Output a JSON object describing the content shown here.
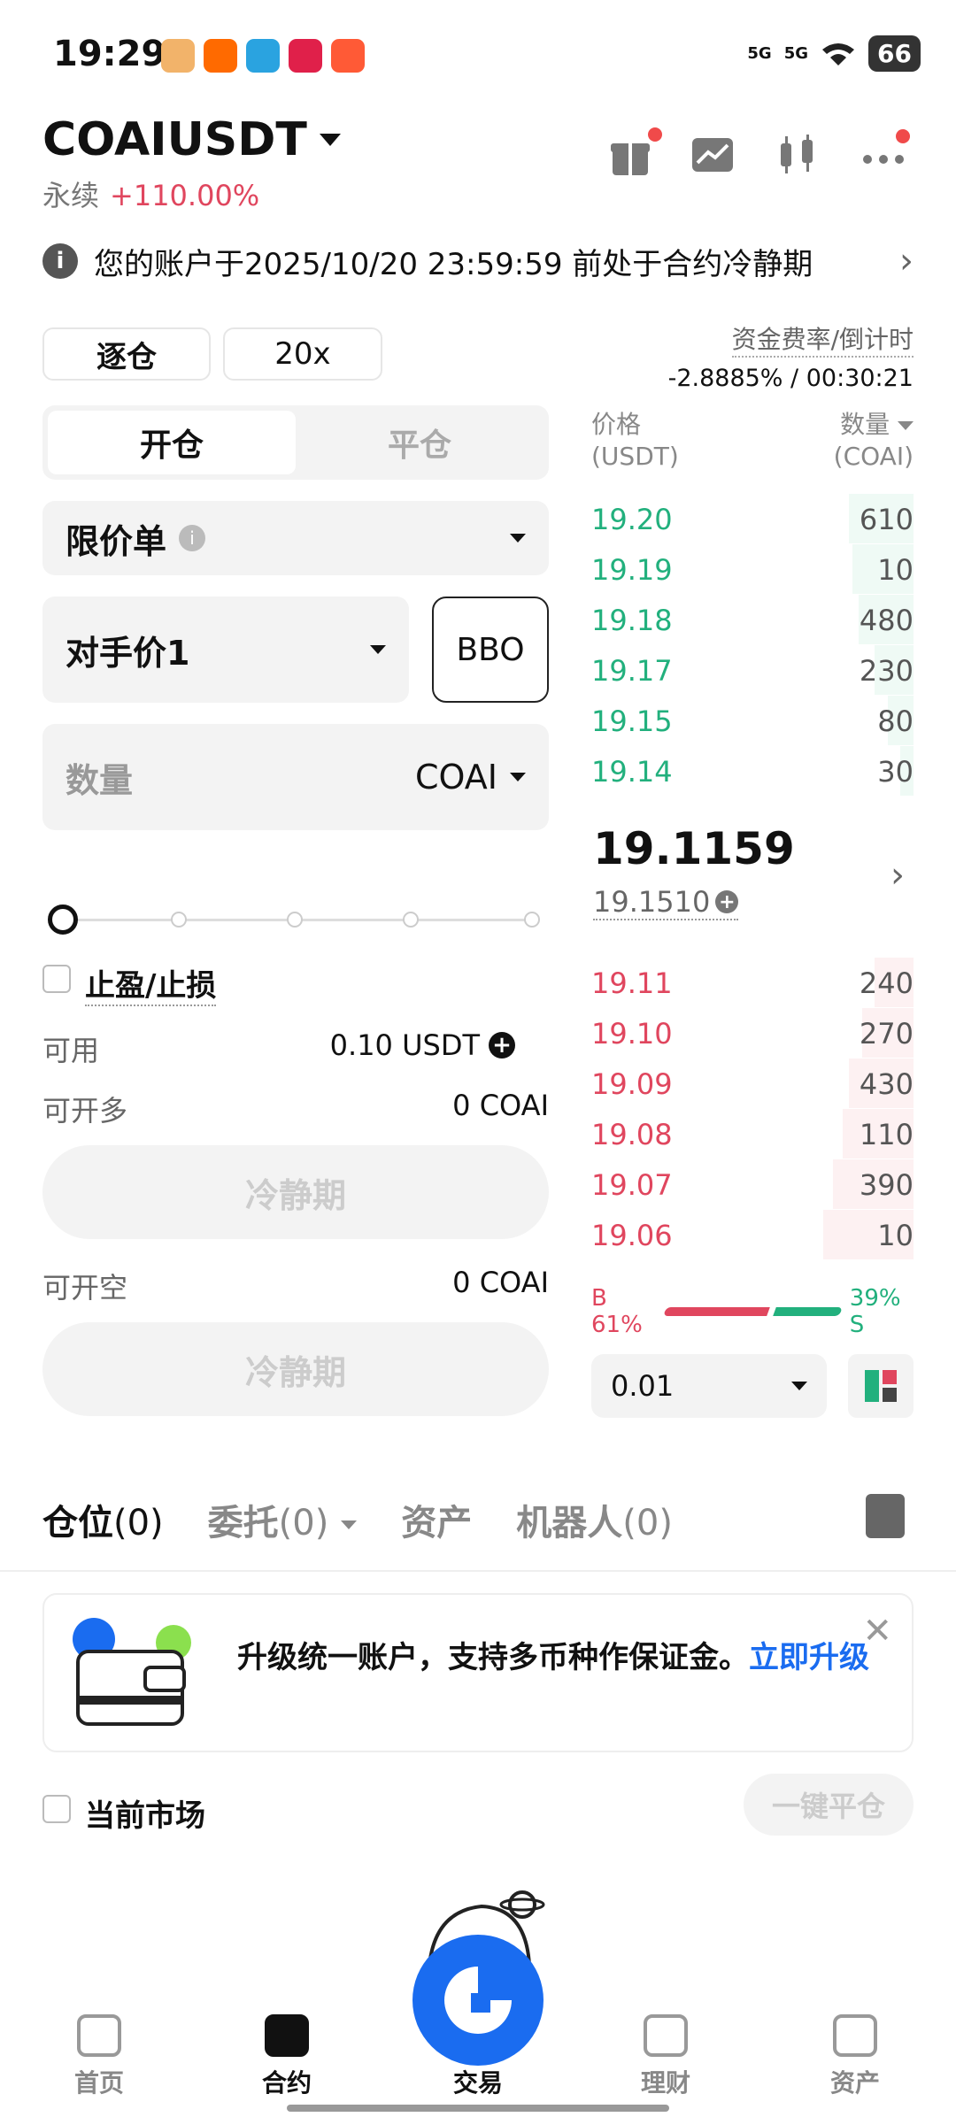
{
  "status_bar": {
    "time": "19:29",
    "signal1": "5G",
    "signal2": "5G",
    "battery": "66"
  },
  "header": {
    "pair": "COAIUSDT",
    "type": "永续",
    "change": "+110.00%"
  },
  "notice": {
    "text": "您的账户于2025/10/20 23:59:59 前处于合约冷静期"
  },
  "margin_mode": "逐仓",
  "leverage": "20x",
  "funding": {
    "label": "资金费率/倒计时",
    "value": "-2.8885% / 00:30:21"
  },
  "tabs_open_close": {
    "open": "开仓",
    "close": "平仓"
  },
  "order_type": "限价单",
  "price_mode": "对手价1",
  "bbo": "BBO",
  "quantity": {
    "label": "数量",
    "unit": "COAI"
  },
  "slider_percent": 0,
  "tp_sl": "止盈/止损",
  "available": {
    "label": "可用",
    "value": "0.10 USDT"
  },
  "can_long": {
    "label": "可开多",
    "value": "0 COAI"
  },
  "long_button": "冷静期",
  "can_short": {
    "label": "可开空",
    "value": "0 COAI"
  },
  "short_button": "冷静期",
  "orderbook": {
    "price_header": "价格",
    "price_unit": "(USDT)",
    "qty_header": "数量",
    "qty_unit": "(COAI)",
    "asks": [
      {
        "price": "19.20",
        "qty": "610",
        "depth": 0.2
      },
      {
        "price": "19.19",
        "qty": "10",
        "depth": 0.19
      },
      {
        "price": "19.18",
        "qty": "480",
        "depth": 0.17
      },
      {
        "price": "19.17",
        "qty": "230",
        "depth": 0.12
      },
      {
        "price": "19.15",
        "qty": "80",
        "depth": 0.08
      },
      {
        "price": "19.14",
        "qty": "30",
        "depth": 0.04
      }
    ],
    "last_price": "19.1159",
    "mark_price": "19.1510",
    "bids": [
      {
        "price": "19.11",
        "qty": "240",
        "depth": 0.12
      },
      {
        "price": "19.10",
        "qty": "270",
        "depth": 0.16
      },
      {
        "price": "19.09",
        "qty": "430",
        "depth": 0.2
      },
      {
        "price": "19.08",
        "qty": "110",
        "depth": 0.22
      },
      {
        "price": "19.07",
        "qty": "390",
        "depth": 0.25
      },
      {
        "price": "19.06",
        "qty": "10",
        "depth": 0.28
      }
    ],
    "buy_ratio_label": "B 61%",
    "sell_ratio_label": "39% S",
    "buy_ratio": 61,
    "precision": "0.01"
  },
  "bottom_tabs": [
    {
      "label": "仓位",
      "count": "(0)"
    },
    {
      "label": "委托",
      "count": "(0)"
    },
    {
      "label": "资产",
      "count": ""
    },
    {
      "label": "机器人",
      "count": "(0)"
    }
  ],
  "banner": {
    "text": "升级统一账户，支持多币种作保证金。",
    "link": "立即升级"
  },
  "current_market": "当前市场",
  "one_click_close": "一键平仓",
  "nav": [
    {
      "label": "首页"
    },
    {
      "label": "合约"
    },
    {
      "label": "交易"
    },
    {
      "label": "理财"
    },
    {
      "label": "资产"
    }
  ],
  "colors": {
    "green": "#22b07d",
    "red": "#e0465e",
    "accent": "#1a6cf0"
  }
}
